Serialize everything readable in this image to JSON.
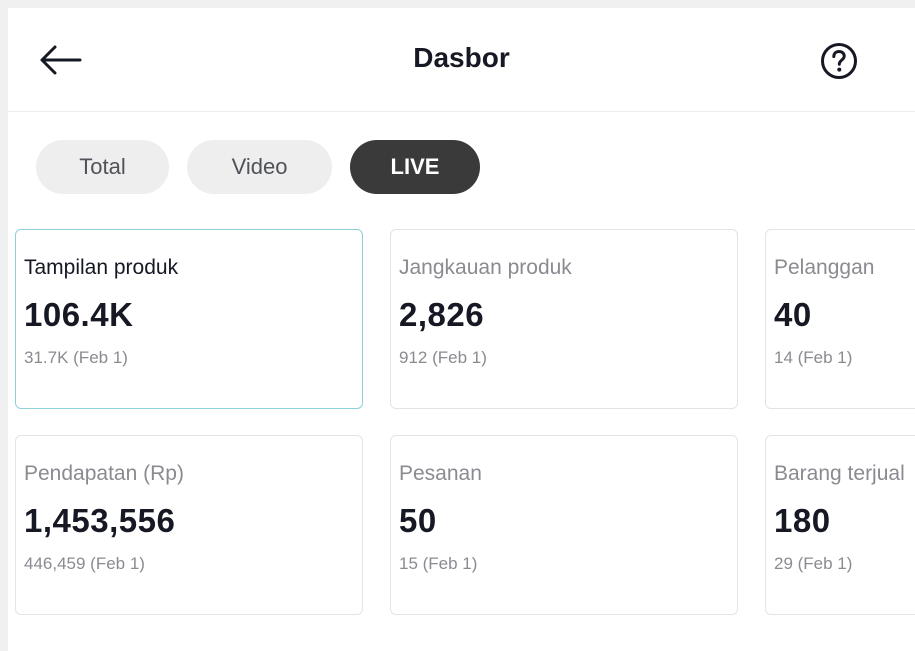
{
  "header": {
    "title": "Dasbor",
    "back_icon": "arrow-left-icon",
    "help_icon": "question-circle-icon"
  },
  "tabs": [
    {
      "label": "Total",
      "active": false
    },
    {
      "label": "Video",
      "active": false
    },
    {
      "label": "LIVE",
      "active": true
    }
  ],
  "metrics": [
    {
      "label": "Tampilan produk",
      "value": "106.4K",
      "sub": "31.7K (Feb 1)",
      "selected": true
    },
    {
      "label": "Jangkauan produk",
      "value": "2,826",
      "sub": "912 (Feb 1)",
      "selected": false
    },
    {
      "label": "Pelanggan",
      "value": "40",
      "sub": "14 (Feb 1)",
      "selected": false
    },
    {
      "label": "Pendapatan (Rp)",
      "value": "1,453,556",
      "sub": "446,459 (Feb 1)",
      "selected": false
    },
    {
      "label": "Pesanan",
      "value": "50",
      "sub": "15 (Feb 1)",
      "selected": false
    },
    {
      "label": "Barang terjual",
      "value": "180",
      "sub": "29 (Feb 1)",
      "selected": false
    }
  ],
  "colors": {
    "active_tab": "#3a3a3a",
    "selected_card_border": "#8fd0d8",
    "text_primary": "#161823",
    "text_secondary": "#8a8b91"
  }
}
